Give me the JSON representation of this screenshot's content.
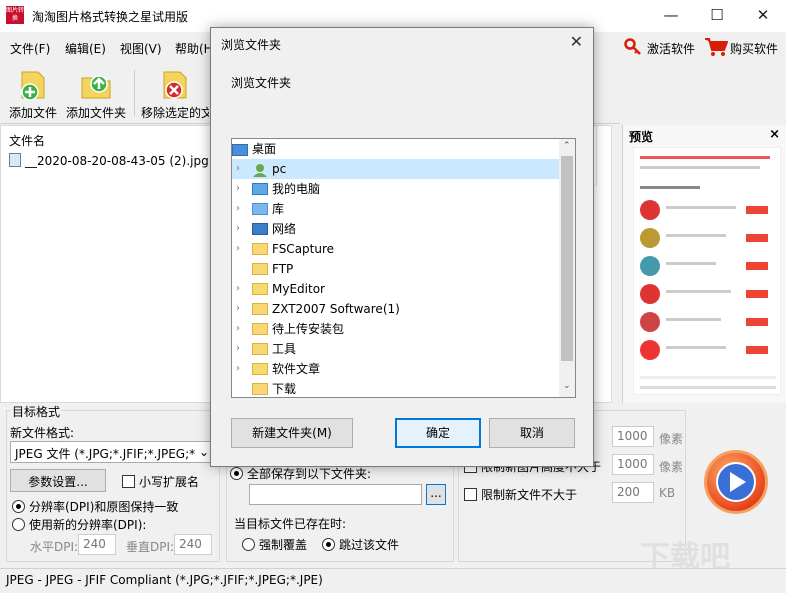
{
  "app": {
    "icon_text": "图片转换",
    "title": "淘淘图片格式转换之星试用版",
    "window_buttons": {
      "minimize": "—",
      "maximize": "☐",
      "close": "✕"
    }
  },
  "menu": {
    "file": "文件(F)",
    "edit": "编辑(E)",
    "view": "视图(V)",
    "help": "帮助(H",
    "activate": "激活软件",
    "buy": "购买软件"
  },
  "toolbar": {
    "add_file": "添加文件",
    "add_folder": "添加文件夹",
    "remove_selected": "移除选定的文"
  },
  "filelist": {
    "column_name": "文件名",
    "files": [
      "__2020-08-20-08-43-05 (2).jpg"
    ]
  },
  "preview": {
    "title": "预览",
    "close": "×"
  },
  "target_format": {
    "group_title": "目标格式",
    "new_format_label": "新文件格式:",
    "format_value": "JPEG 文件 (*.JPG;*.JFIF;*.JPEG;*",
    "params_button": "参数设置...",
    "lowercase_ext": "小写扩展名",
    "keep_dpi": "分辨率(DPI)和原图保持一致",
    "new_dpi": "使用新的分辨率(DPI):",
    "h_dpi_label": "水平DPI:",
    "h_dpi_value": "240",
    "v_dpi_label": "垂直DPI:",
    "v_dpi_value": "240"
  },
  "output": {
    "save_all_to": "全部保存到以下文件夹:",
    "browse_button": "...",
    "exists_label": "当目标文件已存在时:",
    "overwrite": "强制覆盖",
    "skip": "跳过该文件"
  },
  "size_limits": {
    "width_value": "1000",
    "width_unit": "像素",
    "height_label": "限制新图片高度不大于",
    "height_value": "1000",
    "height_unit": "像素",
    "file_size_label": "限制新文件不大于",
    "file_size_value": "200",
    "file_size_unit": "KB"
  },
  "status": {
    "text": "JPEG - JPEG - JFIF Compliant (*.JPG;*.JFIF;*.JPEG;*.JPE)"
  },
  "dialog": {
    "title": "浏览文件夹",
    "close": "✕",
    "description": "浏览文件夹",
    "tree": [
      {
        "label": "桌面",
        "chevron": "",
        "icon": "desktop-icon"
      },
      {
        "label": "pc",
        "chevron": "›",
        "icon": "user-icon"
      },
      {
        "label": "我的电脑",
        "chevron": "›",
        "icon": "computer-icon"
      },
      {
        "label": "库",
        "chevron": "›",
        "icon": "library-icon"
      },
      {
        "label": "网络",
        "chevron": "›",
        "icon": "network-icon"
      },
      {
        "label": "FSCapture",
        "chevron": "›",
        "icon": "folder-icon"
      },
      {
        "label": "FTP",
        "chevron": "",
        "icon": "folder-icon"
      },
      {
        "label": "MyEditor",
        "chevron": "›",
        "icon": "folder-icon"
      },
      {
        "label": "ZXT2007 Software(1)",
        "chevron": "›",
        "icon": "folder-icon"
      },
      {
        "label": "待上传安装包",
        "chevron": "›",
        "icon": "folder-icon"
      },
      {
        "label": "工具",
        "chevron": "›",
        "icon": "folder-icon"
      },
      {
        "label": "软件文章",
        "chevron": "›",
        "icon": "folder-icon"
      },
      {
        "label": "下载",
        "chevron": "",
        "icon": "folder-icon"
      }
    ],
    "new_folder": "新建文件夹(M)",
    "ok": "确定",
    "cancel": "取消"
  },
  "watermark": "下载吧",
  "colors": {
    "accent_red": "#c8102e",
    "dialog_focus": "#0078d7",
    "tree_selected": "#cce8ff"
  }
}
